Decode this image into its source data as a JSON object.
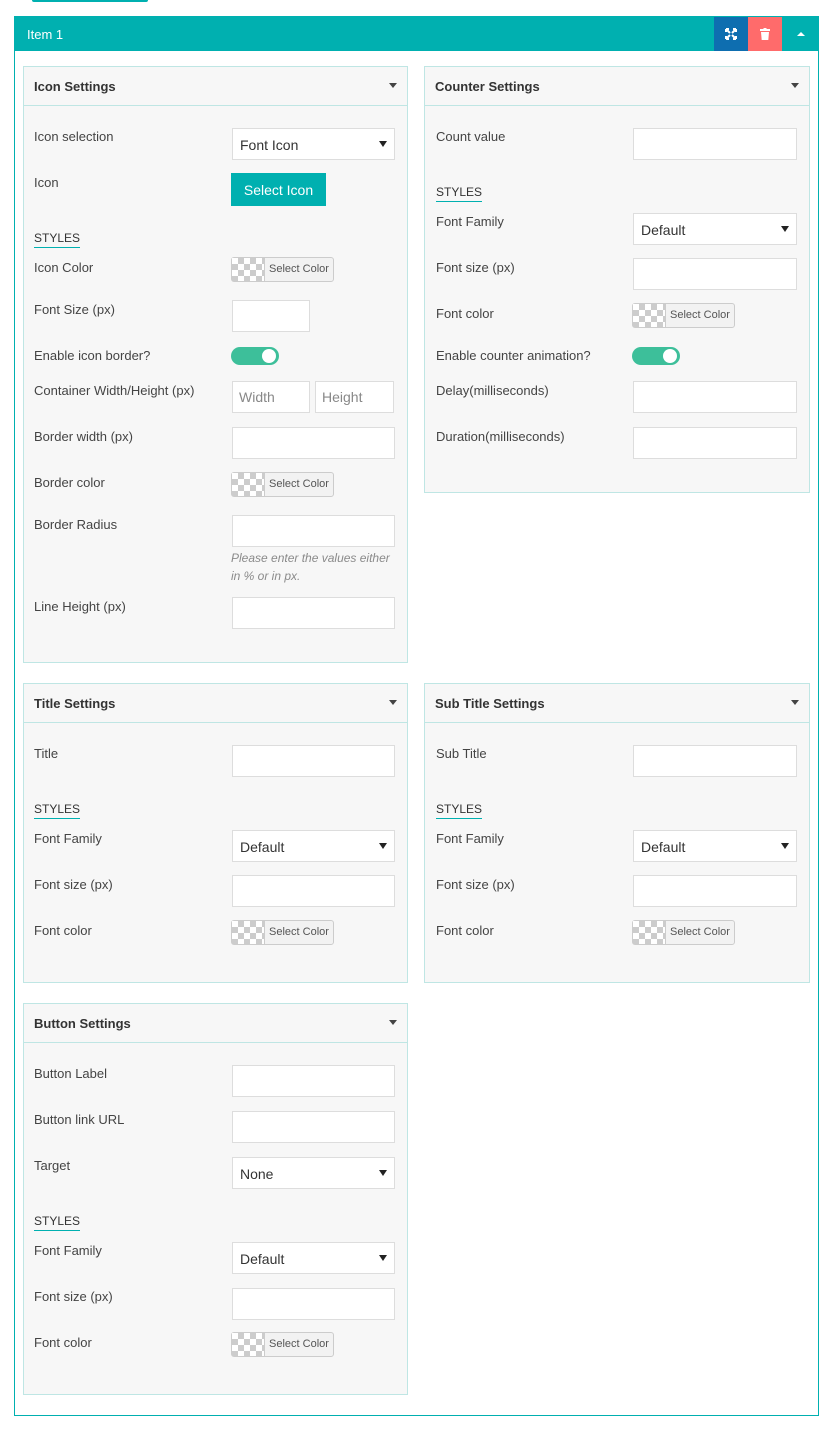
{
  "item": {
    "title": "Item 1",
    "actions": {
      "expand": "expand-icon",
      "delete": "trash-icon",
      "collapse": "caret-up-icon"
    }
  },
  "styles_label": "STYLES",
  "select_color_label": "Select Color",
  "icon_settings": {
    "title": "Icon Settings",
    "icon_selection_label": "Icon selection",
    "icon_selection_value": "Font Icon",
    "icon_label": "Icon",
    "select_icon_button": "Select Icon",
    "icon_color_label": "Icon Color",
    "font_size_label": "Font Size (px)",
    "enable_border_label": "Enable icon border?",
    "enable_border_on": true,
    "container_label": "Container Width/Height (px)",
    "width_placeholder": "Width",
    "height_placeholder": "Height",
    "border_width_label": "Border width (px)",
    "border_color_label": "Border color",
    "border_radius_label": "Border Radius",
    "border_radius_hint": "Please enter the values either in % or in px.",
    "line_height_label": "Line Height (px)"
  },
  "counter_settings": {
    "title": "Counter Settings",
    "count_value_label": "Count value",
    "font_family_label": "Font Family",
    "font_family_value": "Default",
    "font_size_label": "Font size (px)",
    "font_color_label": "Font color",
    "animation_label": "Enable counter animation?",
    "animation_on": true,
    "delay_label": "Delay(milliseconds)",
    "duration_label": "Duration(milliseconds)"
  },
  "title_settings": {
    "title": "Title Settings",
    "title_label": "Title",
    "font_family_label": "Font Family",
    "font_family_value": "Default",
    "font_size_label": "Font size (px)",
    "font_color_label": "Font color"
  },
  "subtitle_settings": {
    "title": "Sub Title Settings",
    "subtitle_label": "Sub Title",
    "font_family_label": "Font Family",
    "font_family_value": "Default",
    "font_size_label": "Font size (px)",
    "font_color_label": "Font color"
  },
  "button_settings": {
    "title": "Button Settings",
    "button_label_label": "Button Label",
    "link_url_label": "Button link URL",
    "target_label": "Target",
    "target_value": "None",
    "font_family_label": "Font Family",
    "font_family_value": "Default",
    "font_size_label": "Font size (px)",
    "font_color_label": "Font color"
  },
  "colors": {
    "accent": "#00b0b0",
    "expand_button": "#0e6eb0",
    "delete_button": "#ff6b6b",
    "toggle_on": "#3dbf9a"
  }
}
